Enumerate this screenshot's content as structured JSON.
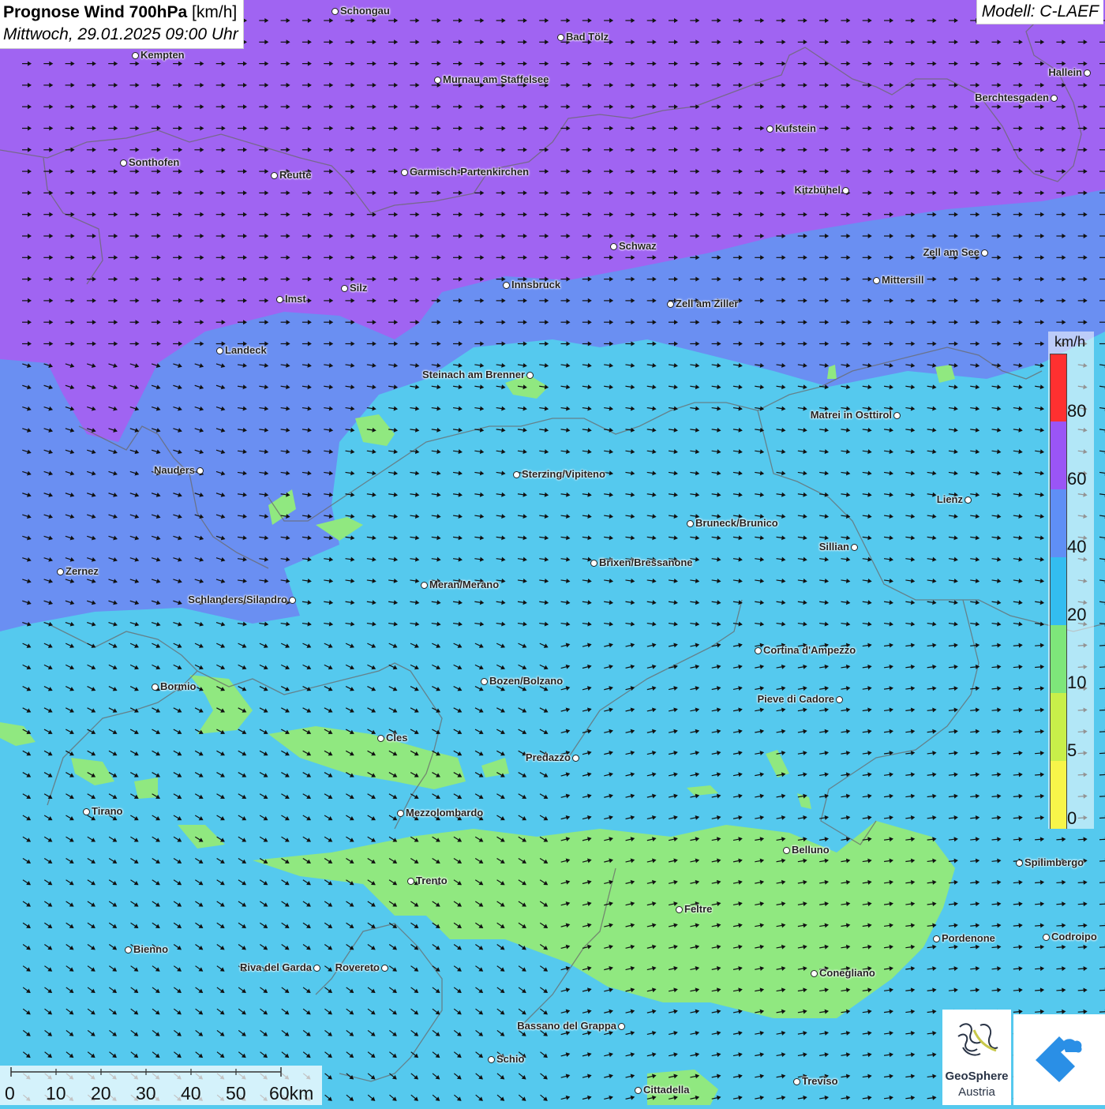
{
  "header": {
    "title_bold": "Prognose Wind 700hPa",
    "title_unit": "[km/h]",
    "datetime": "Mittwoch, 29.01.2025 09:00 Uhr",
    "model": "Modell: C-LAEF"
  },
  "cities": [
    {
      "name": "Schongau"
    },
    {
      "name": "Bad Tölz"
    },
    {
      "name": "Kempten"
    },
    {
      "name": "Murnau am Staffelsee"
    },
    {
      "name": "Hallein"
    },
    {
      "name": "Berchtesgaden"
    },
    {
      "name": "Kufstein"
    },
    {
      "name": "Sonthofen"
    },
    {
      "name": "Reutte"
    },
    {
      "name": "Garmisch-Partenkirchen"
    },
    {
      "name": "Kitzbühel"
    },
    {
      "name": "Schwaz"
    },
    {
      "name": "Zell am See"
    },
    {
      "name": "Mittersill"
    },
    {
      "name": "Innsbruck"
    },
    {
      "name": "Silz"
    },
    {
      "name": "Imst"
    },
    {
      "name": "Zell am Ziller"
    },
    {
      "name": "Landeck"
    },
    {
      "name": "Steinach am Brenner"
    },
    {
      "name": "Matrei in Osttirol"
    },
    {
      "name": "Nauders"
    },
    {
      "name": "Sterzing/Vipiteno"
    },
    {
      "name": "Lienz"
    },
    {
      "name": "Bruneck/Brunico"
    },
    {
      "name": "Sillian"
    },
    {
      "name": "Zernez"
    },
    {
      "name": "Brixen/Bressanone"
    },
    {
      "name": "Meran/Merano"
    },
    {
      "name": "Schlanders/Silandro"
    },
    {
      "name": "Cortina d'Ampezzo"
    },
    {
      "name": "Bozen/Bolzano"
    },
    {
      "name": "Bormio"
    },
    {
      "name": "Pieve di Cadore"
    },
    {
      "name": "Cles"
    },
    {
      "name": "Predazzo"
    },
    {
      "name": "Tirano"
    },
    {
      "name": "Mezzolombardo"
    },
    {
      "name": "Belluno"
    },
    {
      "name": "Spilimbergo"
    },
    {
      "name": "Trento"
    },
    {
      "name": "Feltre"
    },
    {
      "name": "Pordenone"
    },
    {
      "name": "Codroipo"
    },
    {
      "name": "Bienno"
    },
    {
      "name": "Riva del Garda"
    },
    {
      "name": "Rovereto"
    },
    {
      "name": "Conegliano"
    },
    {
      "name": "Bassano del Grappa"
    },
    {
      "name": "Schio"
    },
    {
      "name": "Treviso"
    },
    {
      "name": "Cittadella"
    }
  ],
  "legend": {
    "unit": "km/h",
    "ticks": [
      "80",
      "60",
      "40",
      "20",
      "10",
      "5",
      "0"
    ],
    "colors": [
      "#ff3030",
      "#9a55f5",
      "#5f8ff5",
      "#33bdf0",
      "#7ee67a",
      "#c8ef4a",
      "#f7f54a"
    ]
  },
  "scale": {
    "labels": [
      "0",
      "10",
      "20",
      "30",
      "40",
      "50",
      "60km"
    ]
  },
  "logo": {
    "name": "GeoSphere",
    "subtitle": "Austria"
  },
  "colors": {
    "purple": "#a064f2",
    "blue": "#6a8ff2",
    "cyan": "#55c9ee",
    "green": "#90e880"
  }
}
